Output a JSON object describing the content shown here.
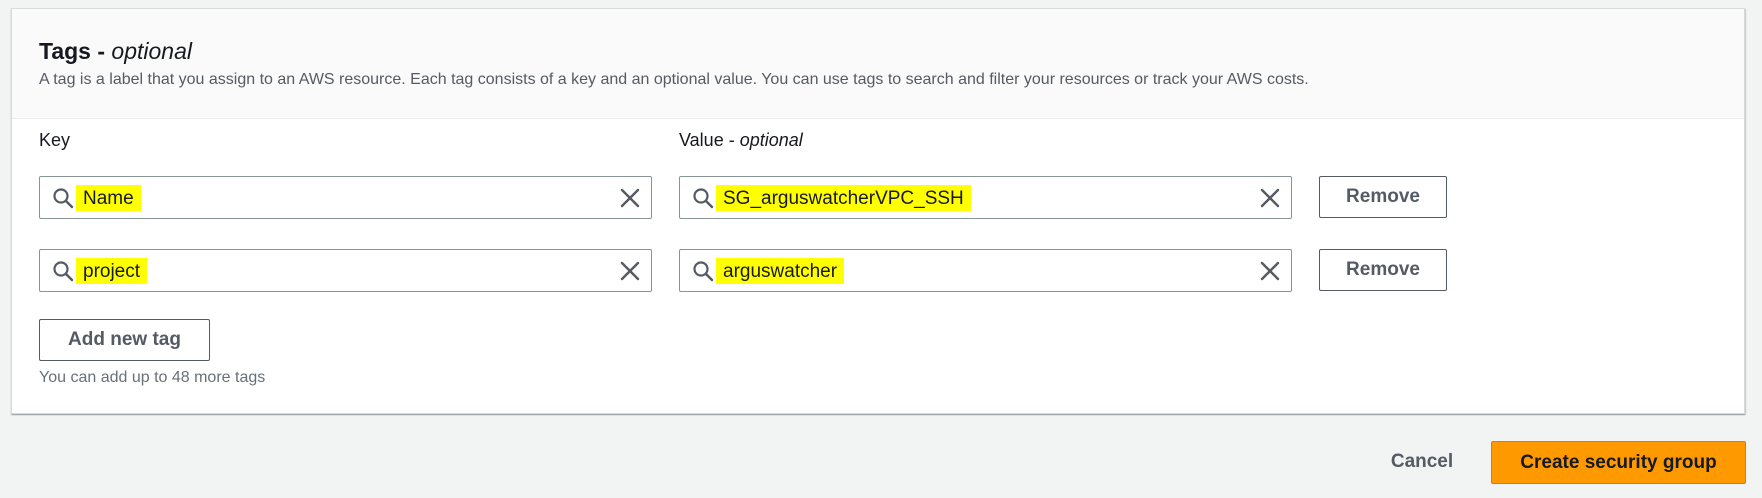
{
  "tags_section": {
    "title": "Tags -",
    "title_optional": "optional",
    "description": "A tag is a label that you assign to an AWS resource. Each tag consists of a key and an optional value. You can use tags to search and filter your resources or track your AWS costs.",
    "key_label": "Key",
    "value_label": "Value -",
    "value_label_optional": "optional",
    "rows": [
      {
        "key": "Name",
        "value": "SG_arguswatcherVPC_SSH",
        "remove_label": "Remove"
      },
      {
        "key": "project",
        "value": "arguswatcher",
        "remove_label": "Remove"
      }
    ],
    "add_tag_label": "Add new tag",
    "hint": "You can add up to 48 more tags"
  },
  "footer": {
    "cancel_label": "Cancel",
    "create_label": "Create security group"
  },
  "colors": {
    "primary": "#ff9900",
    "highlight": "#ffff00",
    "border": "#879596"
  },
  "icons": {
    "search": "search-icon",
    "clear": "close-icon"
  }
}
